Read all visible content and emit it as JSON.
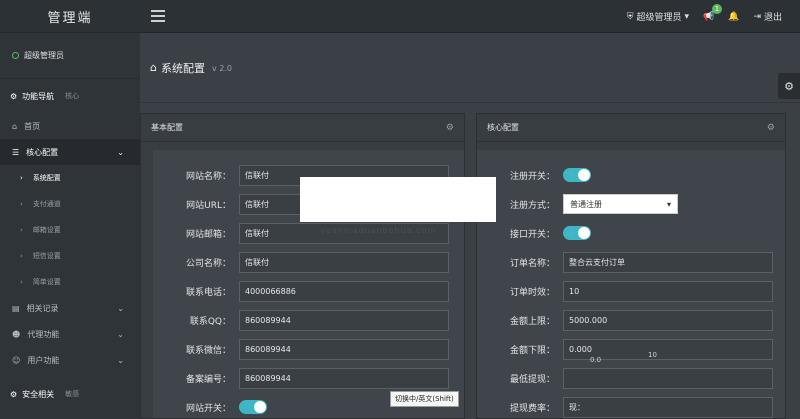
{
  "app": {
    "logo": "管理端"
  },
  "topbar": {
    "admin_label": "超级管理员",
    "notify_count": "1",
    "logout_label": "退出"
  },
  "sidebar": {
    "user_label": "超级管理员",
    "nav_title": "功能导航",
    "nav_sub": "核心",
    "items": [
      {
        "label": "首页"
      },
      {
        "label": "核心配置"
      },
      {
        "label": "相关记录"
      },
      {
        "label": "代理功能"
      },
      {
        "label": "用户功能"
      }
    ],
    "subitems": [
      {
        "label": "系统配置"
      },
      {
        "label": "支付通道"
      },
      {
        "label": "邮箱设置"
      },
      {
        "label": "短信设置"
      },
      {
        "label": "简单设置"
      }
    ],
    "security_title": "安全相关",
    "security_sub": "敏感"
  },
  "page": {
    "title": "系统配置",
    "version": "v 2.0"
  },
  "basic_panel": {
    "title": "基本配置",
    "fields": [
      {
        "label": "网站名称：",
        "value": "信联付"
      },
      {
        "label": "网站URL：",
        "value": "信联付"
      },
      {
        "label": "网站邮箱：",
        "value": "信联付"
      },
      {
        "label": "公司名称：",
        "value": "信联付"
      },
      {
        "label": "联系电话：",
        "value": "4000066886"
      },
      {
        "label": "联系QQ：",
        "value": "860089944"
      },
      {
        "label": "联系微信：",
        "value": "860089944"
      },
      {
        "label": "备案编号：",
        "value": "860089944"
      },
      {
        "label": "网站开关：",
        "value": ""
      }
    ]
  },
  "core_panel": {
    "title": "核心配置",
    "register_switch_label": "注册开关：",
    "register_mode_label": "注册方式：",
    "register_mode_value": "普通注册",
    "interface_switch_label": "接口开关：",
    "order_name_label": "订单名称：",
    "order_name_value": "整合云支付订单",
    "order_time_label": "订单时效：",
    "order_time_value": "10",
    "amount_max_label": "金额上限：",
    "amount_max_value": "5000.000",
    "amount_min_label": "金额下限：",
    "amount_min_value": "0.000",
    "min_withdraw_label": "最低提现：",
    "fee_label": "提现费率：",
    "fee_value": "现："
  },
  "overlay": {
    "tooltip": "切换中/英文(Shift)",
    "watermark": "yuanmaquanbohua.com",
    "garble_1": "0.0",
    "garble_2": "10"
  }
}
